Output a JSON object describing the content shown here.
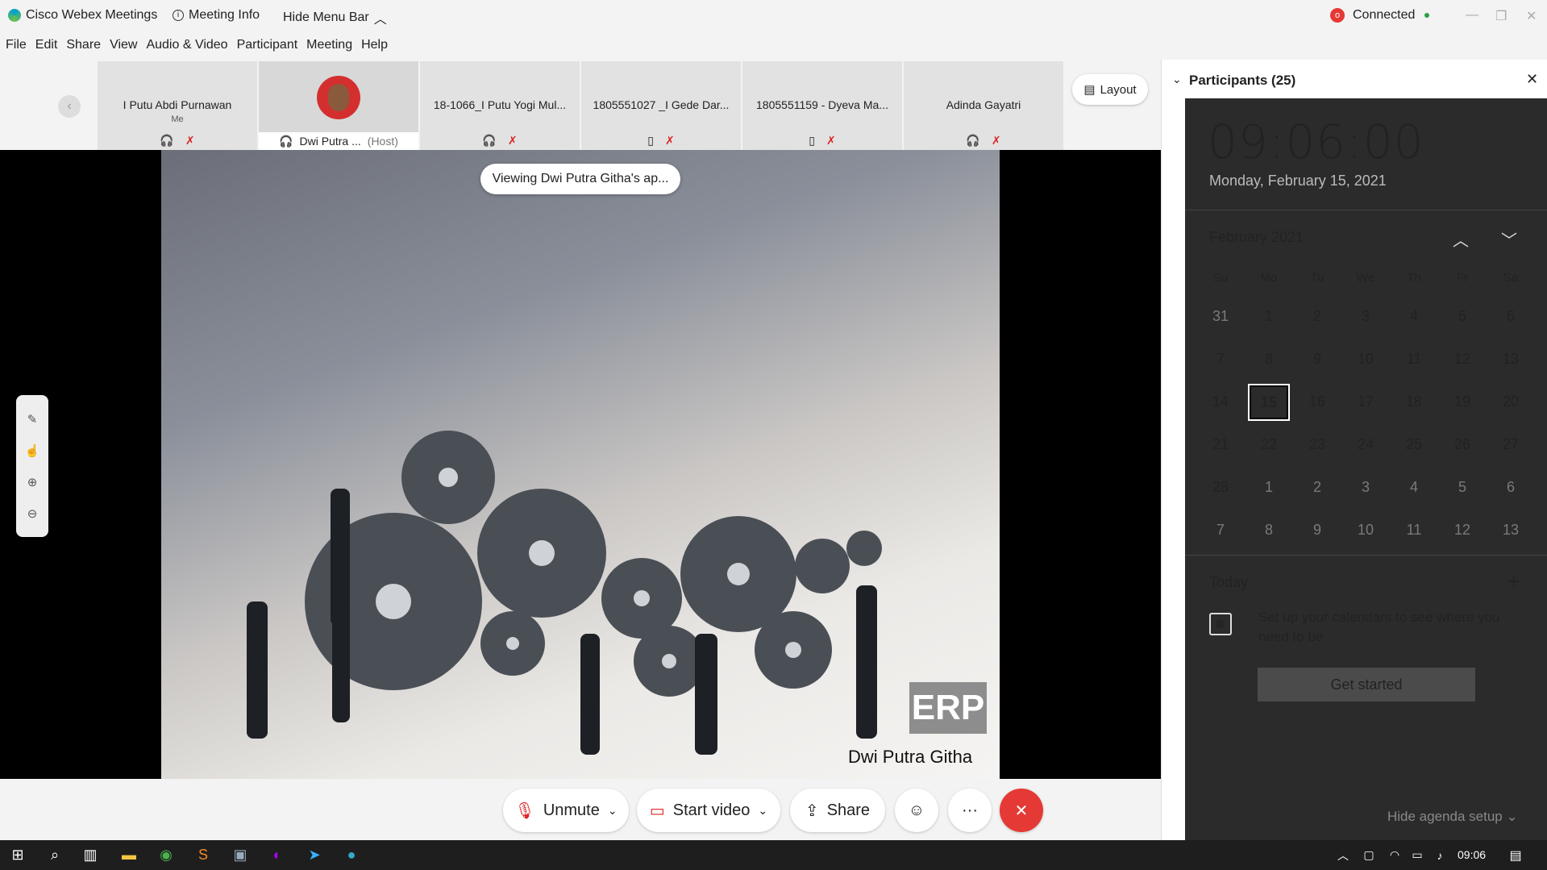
{
  "title_bar": {
    "app_name": "Cisco Webex Meetings",
    "meeting_info": "Meeting Info",
    "hide_menu": "Hide Menu Bar",
    "status": "Connected"
  },
  "menu": [
    "File",
    "Edit",
    "Share",
    "View",
    "Audio & Video",
    "Participant",
    "Meeting",
    "Help"
  ],
  "participants_strip": [
    {
      "name": "I Putu Abdi Purnawan",
      "sub": "Me"
    },
    {
      "name": "Dwi Putra ...",
      "sub": "(Host)"
    },
    {
      "name": "18-1066_I Putu Yogi Mul..."
    },
    {
      "name": "1805551027 _I Gede Dar..."
    },
    {
      "name": "1805551159 - Dyeva Ma..."
    },
    {
      "name": "Adinda Gayatri"
    }
  ],
  "layout_button": "Layout",
  "viewing_toast": "Viewing Dwi Putra Githa's ap...",
  "slide": {
    "watermark": "ERP",
    "presenter": "Dwi Putra Githa"
  },
  "controls": {
    "unmute": "Unmute",
    "start_video": "Start video",
    "share": "Share"
  },
  "panel": {
    "title": "Participants (25)"
  },
  "calendar": {
    "time": "09:06:00",
    "date": "Monday, February 15, 2021",
    "month": "February 2021",
    "dow": [
      "Su",
      "Mo",
      "Tu",
      "We",
      "Th",
      "Fr",
      "Sa"
    ],
    "days": [
      [
        "31",
        "1",
        "2",
        "3",
        "4",
        "5",
        "6"
      ],
      [
        "7",
        "8",
        "9",
        "10",
        "11",
        "12",
        "13"
      ],
      [
        "14",
        "15",
        "16",
        "17",
        "18",
        "19",
        "20"
      ],
      [
        "21",
        "22",
        "23",
        "24",
        "25",
        "26",
        "27"
      ],
      [
        "28",
        "1",
        "2",
        "3",
        "4",
        "5",
        "6"
      ],
      [
        "7",
        "8",
        "9",
        "10",
        "11",
        "12",
        "13"
      ]
    ],
    "today_label": "Today",
    "agenda_text": "Set up your calendars to see where you need to be",
    "get_started": "Get started",
    "hide_agenda": "Hide agenda setup"
  },
  "taskbar": {
    "clock": "09:06"
  },
  "colors": {
    "end_call": "#e53935",
    "flyout_bg": "#2b2b2b",
    "status_dot": "#2e9e44"
  }
}
